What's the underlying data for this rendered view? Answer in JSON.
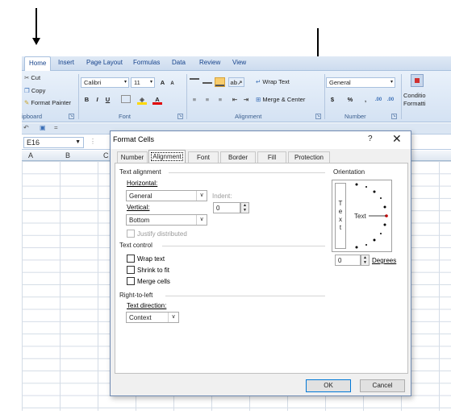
{
  "ribbon": {
    "tabs": [
      "Home",
      "Insert",
      "Page Layout",
      "Formulas",
      "Data",
      "Review",
      "View"
    ],
    "clipboard": {
      "cut": "Cut",
      "copy": "Copy",
      "format_painter": "Format Painter",
      "label": "ipboard"
    },
    "font": {
      "name": "Calibri",
      "size": "11",
      "bold": "B",
      "italic": "I",
      "underline": "U",
      "grow": "A",
      "shrink": "A",
      "label": "Font"
    },
    "alignment": {
      "wrap_text": "Wrap Text",
      "merge_center": "Merge & Center",
      "label": "Alignment"
    },
    "number": {
      "format": "General",
      "currency": "$",
      "percent": "%",
      "comma": ",",
      "inc_dec": ".00",
      "label": "Number"
    },
    "styles": {
      "conditional": "Conditio",
      "conditional2": "Formatti"
    }
  },
  "formula_bar": {
    "name_box": "E16"
  },
  "columns": [
    "A",
    "B",
    "C"
  ],
  "dialog": {
    "title": "Format Cells",
    "help": "?",
    "close": "✕",
    "tabs": [
      "Number",
      "Alignment",
      "Font",
      "Border",
      "Fill",
      "Protection"
    ],
    "text_alignment": {
      "heading": "Text alignment",
      "horizontal_label": "Horizontal:",
      "horizontal_value": "General",
      "indent_label": "Indent:",
      "indent_value": "0",
      "vertical_label": "Vertical:",
      "vertical_value": "Bottom",
      "justify_distributed": "Justify distributed"
    },
    "text_control": {
      "heading": "Text control",
      "wrap_text": "Wrap text",
      "shrink_to_fit": "Shrink to fit",
      "merge_cells": "Merge cells"
    },
    "right_to_left": {
      "heading": "Right-to-left",
      "direction_label": "Text direction:",
      "direction_value": "Context"
    },
    "orientation": {
      "heading": "Orientation",
      "vertical_text": [
        "T",
        "e",
        "x",
        "t"
      ],
      "dial_text": "Text",
      "degrees_value": "0",
      "degrees_label": "Degrees"
    },
    "ok": "OK",
    "cancel": "Cancel"
  }
}
